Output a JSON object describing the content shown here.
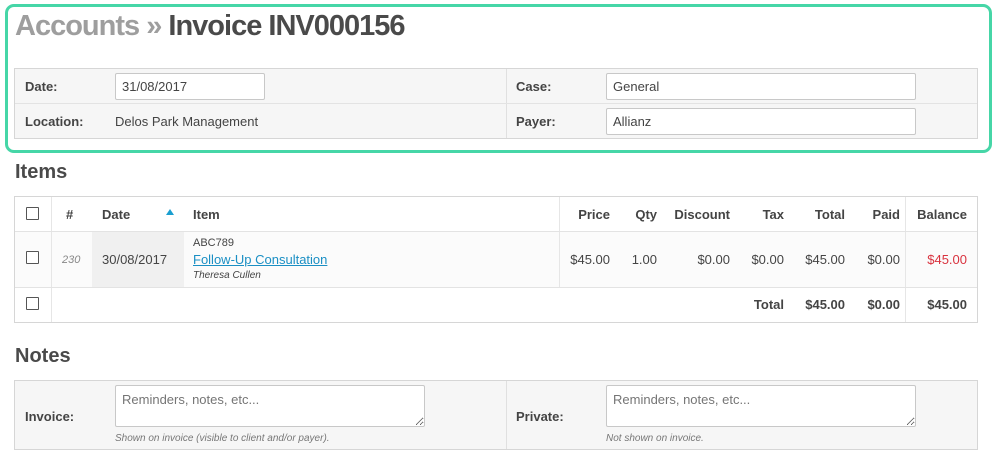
{
  "breadcrumb": {
    "parent": "Accounts",
    "separator": "»",
    "current": "Invoice INV000156"
  },
  "header": {
    "date_label": "Date:",
    "date_value": "31/08/2017",
    "location_label": "Location:",
    "location_value": "Delos Park Management",
    "case_label": "Case:",
    "case_value": "General",
    "payer_label": "Payer:",
    "payer_value": "Allianz"
  },
  "items": {
    "title": "Items",
    "columns": {
      "number": "#",
      "date": "Date",
      "item": "Item",
      "price": "Price",
      "qty": "Qty",
      "discount": "Discount",
      "tax": "Tax",
      "total": "Total",
      "paid": "Paid",
      "balance": "Balance"
    },
    "sort_icon": "sort-ascending-icon",
    "rows": [
      {
        "number": "230",
        "date": "30/08/2017",
        "code": "ABC789",
        "name": "Follow-Up Consultation",
        "provider": "Theresa Cullen",
        "price": "$45.00",
        "qty": "1.00",
        "discount": "$0.00",
        "tax": "$0.00",
        "total": "$45.00",
        "paid": "$0.00",
        "balance": "$45.00"
      }
    ],
    "totals": {
      "label": "Total",
      "total": "$45.00",
      "paid": "$0.00",
      "balance": "$45.00"
    },
    "balance_color": "#d9333f"
  },
  "notes": {
    "title": "Notes",
    "invoice_label": "Invoice:",
    "invoice_placeholder": "Reminders, notes, etc...",
    "invoice_hint": "Shown on invoice (visible to client and/or payer).",
    "private_label": "Private:",
    "private_placeholder": "Reminders, notes, etc...",
    "private_hint": "Not shown on invoice."
  },
  "accent_color": "#46d6a7"
}
